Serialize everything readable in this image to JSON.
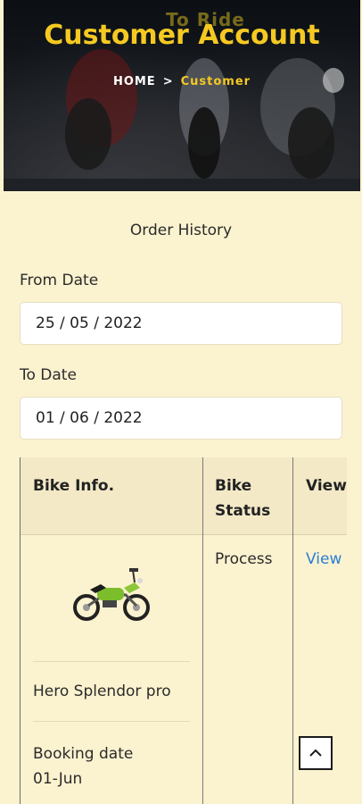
{
  "hero": {
    "background_text": "To Ride",
    "title": "Customer Account",
    "breadcrumb": {
      "home": "HOME",
      "separator": ">",
      "current": "Customer"
    }
  },
  "orders": {
    "title": "Order History",
    "from_label": "From Date",
    "from_value": "25 / 05 / 2022",
    "to_label": "To Date",
    "to_value": "01 / 06 / 2022"
  },
  "table": {
    "headers": [
      "Bike Info.",
      "Bike Status",
      "View"
    ],
    "rows": [
      {
        "bike_name": "Hero Splendor pro",
        "booking_label": "Booking date",
        "booking_date": "01-Jun",
        "status": "Process",
        "view": "View"
      }
    ]
  },
  "colors": {
    "accent": "#f5c922",
    "link": "#2a7fd4",
    "page_bg": "#fbf2cf"
  },
  "icons": {
    "scroll_top": "chevron-up-icon",
    "bike": "motorcycle-image"
  }
}
